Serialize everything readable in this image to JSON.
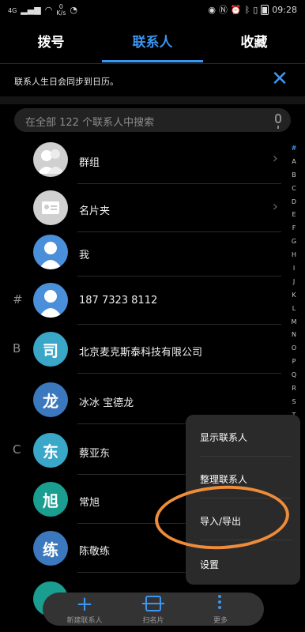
{
  "status_bar": {
    "network": "4G",
    "speed_value": "0",
    "speed_unit": "K/s",
    "time": "09:28"
  },
  "tabs": [
    {
      "label": "拨号",
      "active": false
    },
    {
      "label": "联系人",
      "active": true
    },
    {
      "label": "收藏",
      "active": false
    }
  ],
  "banner": {
    "text": "联系人生日会同步到日历。"
  },
  "search": {
    "placeholder": "在全部 122 个联系人中搜索"
  },
  "contacts": [
    {
      "name": "群组",
      "avatar_type": "group-icon",
      "has_chevron": true
    },
    {
      "name": "名片夹",
      "avatar_type": "card-icon",
      "has_chevron": true
    },
    {
      "name": "我",
      "avatar_type": "person-icon"
    },
    {
      "section": "#",
      "name": "187 7323 8112",
      "avatar_type": "person-icon"
    },
    {
      "section": "B",
      "name": "北京麦克斯泰科技有限公司",
      "avatar_char": "司",
      "color": "#3aa6c8"
    },
    {
      "name": "冰冰 宝德龙",
      "avatar_char": "龙",
      "color": "#3b78bd"
    },
    {
      "section": "C",
      "name": "蔡亚东",
      "avatar_char": "东",
      "color": "#3aa6c8"
    },
    {
      "name": "常旭",
      "avatar_char": "旭",
      "color": "#1a9e8f"
    },
    {
      "name": "陈敬练",
      "avatar_char": "练",
      "color": "#3b78bd"
    },
    {
      "name": "",
      "avatar_char": "",
      "color": "#1a9e8f"
    }
  ],
  "alphabet": [
    "#",
    "A",
    "B",
    "C",
    "D",
    "E",
    "F",
    "G",
    "H",
    "I",
    "J",
    "K",
    "L",
    "M",
    "N",
    "O",
    "P",
    "Q",
    "R",
    "S",
    "T",
    "U",
    "V",
    "W",
    "X",
    "Y",
    "Z"
  ],
  "menu": {
    "items": [
      "显示联系人",
      "整理联系人",
      "导入/导出",
      "设置"
    ]
  },
  "bottom_bar": {
    "new_contact": "新建联系人",
    "scan_card": "扫名片",
    "more": "更多"
  },
  "colors": {
    "accent": "#3c96f0",
    "highlight": "#ef8c3a"
  }
}
